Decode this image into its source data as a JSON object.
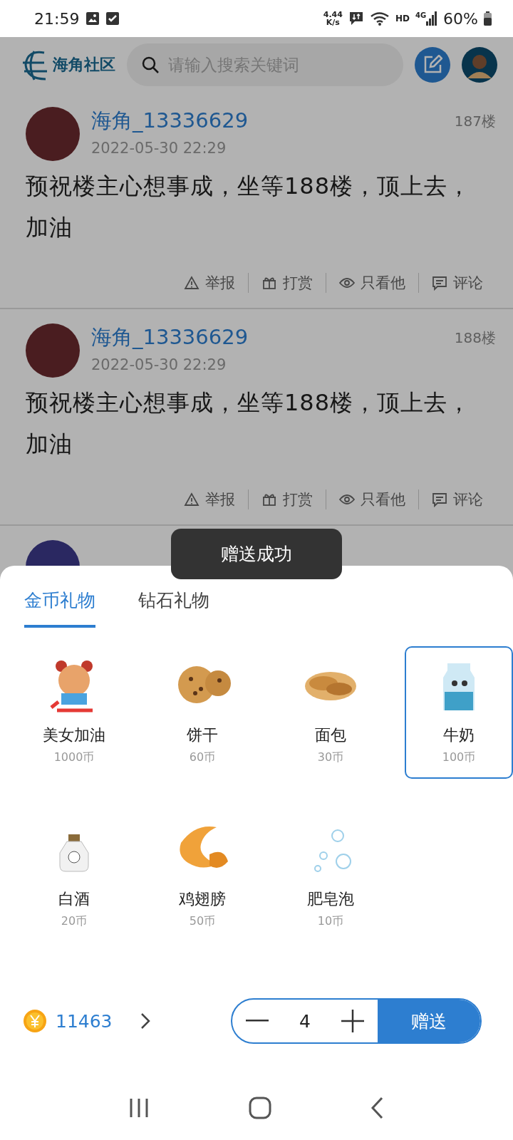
{
  "status_bar": {
    "time": "21:59",
    "net_speed": "4.44",
    "net_unit": "K/s",
    "hd": "HD",
    "network": "4G",
    "battery": "60%"
  },
  "header": {
    "logo": "海角社区",
    "search": {
      "placeholder": "请输入搜索关键词"
    }
  },
  "posts": [
    {
      "user": "海角_13336629",
      "floor": "187楼",
      "time": "2022-05-30 22:29",
      "text": "预祝楼主心想事成，坐等188楼，顶上去，加油",
      "actions": [
        "举报",
        "打赏",
        "只看他",
        "评论"
      ]
    },
    {
      "user": "海角_13336629",
      "floor": "188楼",
      "time": "2022-05-30 22:29",
      "text": "预祝楼主心想事成，坐等188楼，顶上去，加油",
      "actions": [
        "举报",
        "打赏",
        "只看他",
        "评论"
      ]
    }
  ],
  "toast": "赠送成功",
  "gift_sheet": {
    "tabs": [
      {
        "label": "金币礼物",
        "selected": true
      },
      {
        "label": "钻石礼物",
        "selected": false
      }
    ],
    "gifts": [
      {
        "kind": "cheer",
        "name": "美女加油",
        "price": "1000币",
        "selected": false
      },
      {
        "kind": "cookie",
        "name": "饼干",
        "price": "60币",
        "selected": false
      },
      {
        "kind": "bread",
        "name": "面包",
        "price": "30币",
        "selected": false
      },
      {
        "kind": "milk",
        "name": "牛奶",
        "price": "100币",
        "selected": true
      },
      {
        "kind": "liquor",
        "name": "白酒",
        "price": "20币",
        "selected": false
      },
      {
        "kind": "wing",
        "name": "鸡翅膀",
        "price": "50币",
        "selected": false
      },
      {
        "kind": "bubble",
        "name": "肥皂泡",
        "price": "10币",
        "selected": false
      }
    ],
    "balance": "11463",
    "quantity": "4",
    "send": "赠送"
  }
}
